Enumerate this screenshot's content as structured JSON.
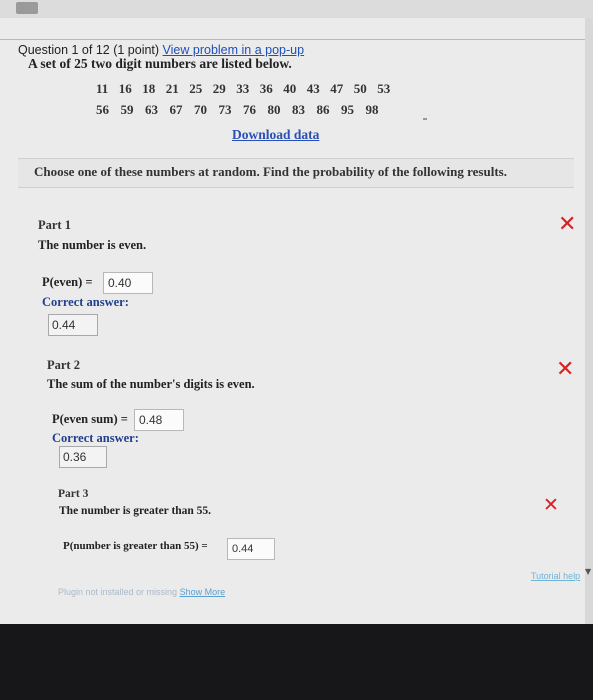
{
  "header": {
    "question_label": "Question 1 of 12 (1 point)",
    "popup_link": "View problem in a pop-up"
  },
  "problem": {
    "intro": "A set of 25 two digit numbers are listed below.",
    "row1": [
      "11",
      "16",
      "18",
      "21",
      "25",
      "29",
      "33",
      "36",
      "40",
      "43",
      "47",
      "50",
      "53"
    ],
    "row2": [
      "56",
      "59",
      "63",
      "67",
      "70",
      "73",
      "76",
      "80",
      "83",
      "86",
      "95",
      "98"
    ],
    "download_label": "Download data",
    "instruction": "Choose one of these numbers at random. Find the probability of the following results."
  },
  "parts": [
    {
      "label": "Part 1",
      "description": "The number is even.",
      "answer_prefix": "P(even) =",
      "answer_value": "0.40",
      "correct_label": "Correct answer:",
      "correct_value": "0.44",
      "status_icon": "x-mark-icon"
    },
    {
      "label": "Part 2",
      "description": "The sum of the number's digits is even.",
      "answer_prefix": "P(even sum) =",
      "answer_value": "0.48",
      "correct_label": "Correct answer:",
      "correct_value": "0.36",
      "status_icon": "x-mark-icon"
    },
    {
      "label": "Part 3",
      "description": "The number is greater than 55.",
      "answer_prefix": "P(number is greater than 55) =",
      "answer_value": "0.44",
      "status_icon": "x-mark-icon"
    }
  ],
  "footer": {
    "plugin_text": "Plugin not installed or missing",
    "show_more": "Show More",
    "tutorial_help": "Tutorial help"
  },
  "colors": {
    "link": "#1f4fb8",
    "wrong": "#d62222",
    "background": "#ebebeb"
  }
}
